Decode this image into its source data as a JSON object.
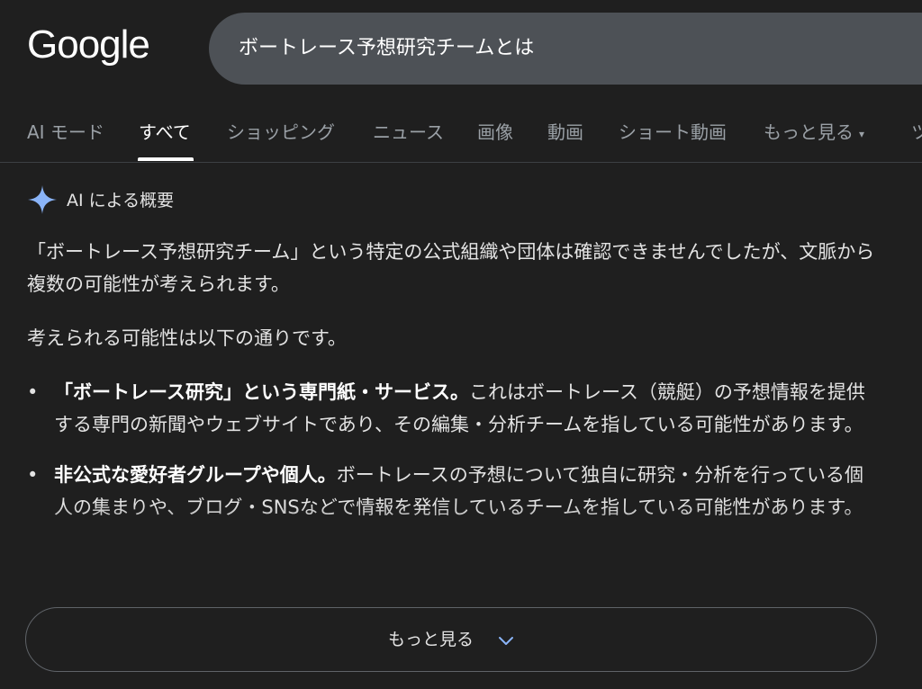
{
  "header": {
    "logo": "Google",
    "search": {
      "query": "ボートレース予想研究チームとは"
    }
  },
  "tabs": [
    {
      "label": "AI モード"
    },
    {
      "label": "すべて",
      "active": true
    },
    {
      "label": "ショッピング"
    },
    {
      "label": "ニュース"
    },
    {
      "label": "画像"
    },
    {
      "label": "動画"
    },
    {
      "label": "ショート動画"
    },
    {
      "label": "もっと見る"
    },
    {
      "label": "ツ"
    }
  ],
  "ai_overview": {
    "title": "AI による概要",
    "icon": "sparkle-icon",
    "paragraph1": "「ボートレース予想研究チーム」という特定の公式組織や団体は確認できませんでしたが、文脈から複数の可能性が考えられます。",
    "paragraph2": "考えられる可能性は以下の通りです。",
    "bullets": [
      {
        "bold": "「ボートレース研究」という専門紙・サービス。",
        "text": "これはボートレース（競艇）の予想情報を提供する専門の新聞やウェブサイトであり、その編集・分析チームを指している可能性があります。"
      },
      {
        "bold": "非公式な愛好者グループや個人。",
        "text": "ボートレースの予想について独自に研究・分析を行っている個人の集まりや、ブログ・SNSなどで情報を発信しているチームを指している可能性があります。"
      }
    ],
    "more_button": "もっと見る"
  },
  "colors": {
    "background": "#1f1f1f",
    "search_bg": "#4d5156",
    "sparkle": "#8ab4f8"
  }
}
